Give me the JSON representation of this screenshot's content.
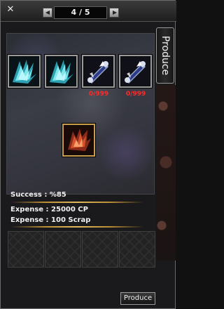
{
  "header": {
    "close_glyph": "✕",
    "page_label": "4 / 5"
  },
  "side_tab": {
    "label": "Produce"
  },
  "ingredients": [
    {
      "icon": "blue-feather-wing-icon",
      "count": ""
    },
    {
      "icon": "blue-feather-wing-icon",
      "count": ""
    },
    {
      "icon": "crystal-scroll-icon",
      "count": "0/999"
    },
    {
      "icon": "crystal-scroll-icon",
      "count": "0/999"
    }
  ],
  "result": {
    "icon": "red-phoenix-wing-icon"
  },
  "stats": {
    "success": "Success : %85",
    "expense_cp": "Expense : 25000 CP",
    "expense_scrap": "Expense : 100 Scrap"
  },
  "footer": {
    "produce_label": "Produce"
  },
  "colors": {
    "count_red": "#ff2a2a",
    "gold": "#c89b4a",
    "rule_gold": "#e0b860"
  }
}
